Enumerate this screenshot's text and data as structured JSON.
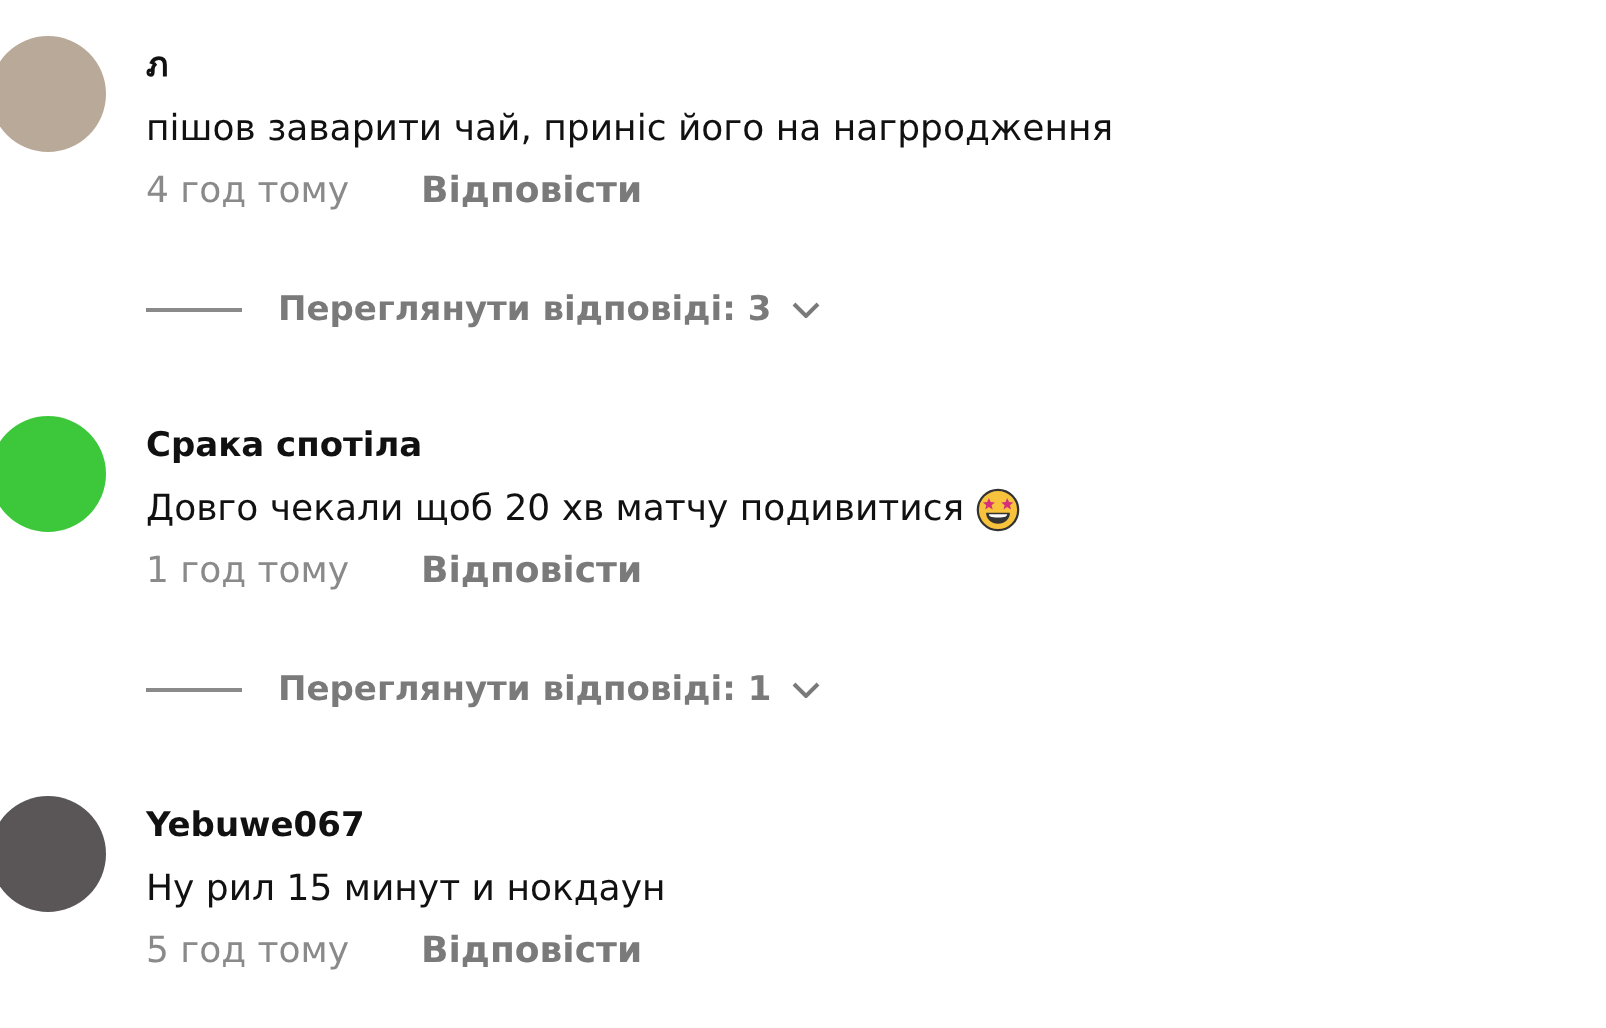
{
  "comments": [
    {
      "author": "ภ",
      "text": "пішов заварити чай, приніс його на нагрродження",
      "emoji": false,
      "time": "4 год тому",
      "reply": "Відповісти",
      "replies": "Переглянути відповіді: 3"
    },
    {
      "author": "Срака спотіла",
      "text": "Довго чекали щоб 20 хв матчу подивитися",
      "emoji": true,
      "time": "1 год тому",
      "reply": "Відповісти",
      "replies": "Переглянути відповіді: 1"
    },
    {
      "author": "Yebuwe067",
      "text": "Ну рил 15 минут и нокдаун",
      "emoji": false,
      "time": "5 год тому",
      "reply": "Відповісти"
    }
  ]
}
